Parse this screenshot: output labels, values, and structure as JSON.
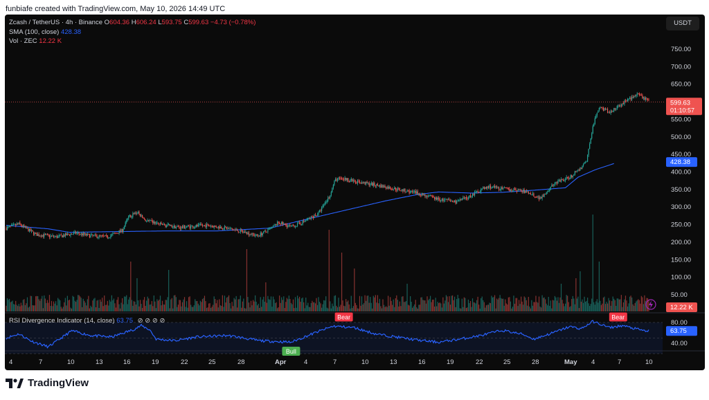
{
  "caption": "funbiafe created with TradingView.com, May 10, 2026 14:49 UTC",
  "currency": "USDT",
  "brand": "TradingView",
  "legend": {
    "symbol": "Zcash / TetherUS · 4h · Binance",
    "o_label": "O",
    "o": "604.36",
    "h_label": "H",
    "h": "606.24",
    "l_label": "L",
    "l": "593.75",
    "c_label": "C",
    "c": "599.63",
    "change": "−4.73 (−0.78%)",
    "sma_label": "SMA (100, close)",
    "sma_value": "428.38",
    "vol_label": "Vol · ZEC",
    "vol_value": "12.22 K",
    "rsi_label": "RSI Divergence Indicator (14, close)",
    "rsi_value": "63.75",
    "rsi_icons": "⊘ ⊘ ⊘ ⊘"
  },
  "chart_data": {
    "type": "candlestick",
    "price_axis": {
      "ticks": [
        750,
        700,
        650,
        600,
        550,
        500,
        450,
        400,
        350,
        300,
        250,
        200,
        150,
        100,
        50
      ],
      "tick_labels": [
        "750.00",
        "700.00",
        "650.00",
        "600.00",
        "550.00",
        "500.00",
        "450.00",
        "400.00",
        "350.00",
        "300.00",
        "250.00",
        "200.00",
        "150.00",
        "100.00",
        "50.00"
      ]
    },
    "rsi_axis": {
      "ticks": [
        80,
        40
      ],
      "tick_labels": [
        "80.00",
        "40.00"
      ]
    },
    "x_labels": [
      "4",
      "7",
      "10",
      "13",
      "16",
      "19",
      "22",
      "25",
      "28",
      "Apr",
      "4",
      "7",
      "10",
      "13",
      "16",
      "19",
      "22",
      "25",
      "28",
      "May",
      "4",
      "7",
      "10"
    ],
    "last_price": {
      "value": 599.63,
      "label": "599.63",
      "countdown": "01:10:57"
    },
    "sma_last": {
      "value": 428.38,
      "label": "428.38"
    },
    "vol_last": {
      "label": "12.22 K"
    },
    "rsi_last": {
      "value": 63.75,
      "label": "63.75"
    },
    "price_anchors": [
      [
        0,
        240
      ],
      [
        12,
        252
      ],
      [
        28,
        222
      ],
      [
        48,
        215
      ],
      [
        66,
        226
      ],
      [
        80,
        218
      ],
      [
        96,
        215
      ],
      [
        110,
        234
      ],
      [
        116,
        272
      ],
      [
        124,
        285
      ],
      [
        132,
        262
      ],
      [
        150,
        248
      ],
      [
        164,
        242
      ],
      [
        190,
        248
      ],
      [
        210,
        240
      ],
      [
        226,
        228
      ],
      [
        238,
        218
      ],
      [
        250,
        236
      ],
      [
        258,
        256
      ],
      [
        270,
        244
      ],
      [
        278,
        252
      ],
      [
        284,
        262
      ],
      [
        296,
        282
      ],
      [
        306,
        330
      ],
      [
        312,
        378
      ],
      [
        318,
        382
      ],
      [
        332,
        372
      ],
      [
        352,
        362
      ],
      [
        372,
        350
      ],
      [
        392,
        338
      ],
      [
        410,
        322
      ],
      [
        426,
        315
      ],
      [
        436,
        325
      ],
      [
        450,
        350
      ],
      [
        458,
        358
      ],
      [
        470,
        352
      ],
      [
        486,
        348
      ],
      [
        496,
        340
      ],
      [
        506,
        325
      ],
      [
        520,
        368
      ],
      [
        534,
        385
      ],
      [
        544,
        410
      ],
      [
        550,
        430
      ],
      [
        556,
        530
      ],
      [
        562,
        585
      ],
      [
        572,
        570
      ],
      [
        582,
        590
      ],
      [
        590,
        608
      ],
      [
        598,
        620
      ],
      [
        608,
        605
      ]
    ],
    "sma_anchors": [
      [
        0,
        248
      ],
      [
        40,
        238
      ],
      [
        60,
        228
      ],
      [
        100,
        230
      ],
      [
        150,
        232
      ],
      [
        200,
        232
      ],
      [
        250,
        240
      ],
      [
        280,
        262
      ],
      [
        320,
        290
      ],
      [
        360,
        318
      ],
      [
        390,
        336
      ],
      [
        410,
        343
      ],
      [
        440,
        340
      ],
      [
        470,
        342
      ],
      [
        500,
        348
      ],
      [
        530,
        355
      ],
      [
        542,
        385
      ],
      [
        558,
        406
      ],
      [
        576,
        424
      ]
    ],
    "volume_spikes": [
      [
        118,
        72
      ],
      [
        124,
        48
      ],
      [
        154,
        60
      ],
      [
        228,
        90
      ],
      [
        246,
        42
      ],
      [
        306,
        118
      ],
      [
        318,
        85
      ],
      [
        330,
        62
      ],
      [
        380,
        40
      ],
      [
        526,
        40
      ],
      [
        540,
        48
      ],
      [
        544,
        58
      ],
      [
        556,
        140
      ],
      [
        562,
        72
      ]
    ],
    "rsi_anchors": [
      [
        0,
        50
      ],
      [
        12,
        58
      ],
      [
        24,
        44
      ],
      [
        40,
        33
      ],
      [
        52,
        50
      ],
      [
        62,
        64
      ],
      [
        80,
        55
      ],
      [
        100,
        52
      ],
      [
        120,
        66
      ],
      [
        128,
        74
      ],
      [
        136,
        66
      ],
      [
        142,
        48
      ],
      [
        160,
        45
      ],
      [
        180,
        52
      ],
      [
        210,
        55
      ],
      [
        240,
        45
      ],
      [
        270,
        42
      ],
      [
        295,
        62
      ],
      [
        310,
        73
      ],
      [
        330,
        70
      ],
      [
        350,
        58
      ],
      [
        370,
        52
      ],
      [
        390,
        46
      ],
      [
        410,
        42
      ],
      [
        430,
        48
      ],
      [
        450,
        55
      ],
      [
        470,
        65
      ],
      [
        490,
        57
      ],
      [
        500,
        48
      ],
      [
        518,
        60
      ],
      [
        534,
        72
      ],
      [
        545,
        68
      ],
      [
        556,
        82
      ],
      [
        572,
        70
      ],
      [
        584,
        74
      ],
      [
        596,
        68
      ],
      [
        606,
        63.75
      ]
    ],
    "signals": [
      {
        "label": "Bear",
        "kind": "bear",
        "i": 320
      },
      {
        "label": "Bull",
        "kind": "bull",
        "i": 270
      },
      {
        "label": "Bear",
        "kind": "bear",
        "i": 580
      }
    ],
    "colors": {
      "up": "#26a69a",
      "down": "#ef5350",
      "sma": "#2962ff",
      "rsi": "#2962ff",
      "bear": "#f23645",
      "bull": "#4caf50"
    }
  }
}
